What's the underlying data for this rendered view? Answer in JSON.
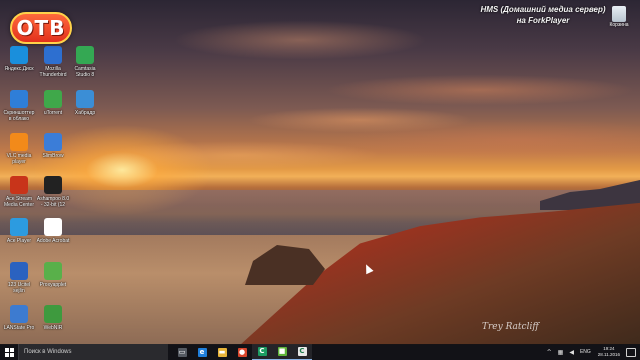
{
  "overlay": {
    "logo_text": "OTB",
    "caption_line1": "HMS (Домашний медиа сервер)",
    "caption_line2": "на ForkPlayer",
    "signature": "Trey Ratcliff"
  },
  "desktop_icons": [
    {
      "label": "Яндекс.Диск",
      "icon": "yandex-disk-icon",
      "color": "#1a8fdc"
    },
    {
      "label": "Mozilla Thunderbird",
      "icon": "thunderbird-icon",
      "color": "#2d6fd0"
    },
    {
      "label": "Camtasia Studio 8",
      "icon": "camtasia-icon",
      "color": "#34a853"
    },
    {
      "label": "Скриншоттер в облако",
      "icon": "screenshot-icon",
      "color": "#2f7ed8"
    },
    {
      "label": "uTorrent",
      "icon": "utorrent-icon",
      "color": "#3fa84a"
    },
    {
      "label": "Хабрадр",
      "icon": "monitor-icon",
      "color": "#3b8ed6"
    },
    {
      "label": "VLC media player",
      "icon": "vlc-icon",
      "color": "#f28a1a"
    },
    {
      "label": "SlimBrow",
      "icon": "slimbrowser-icon",
      "color": "#3b7dd8"
    },
    {
      "label": "Ace Stream Media Center",
      "icon": "acestream-icon",
      "color": "#c8341a"
    },
    {
      "label": "Ashampoo 8.0 - 32-bit (12",
      "icon": "clapper-icon",
      "color": "#222222"
    },
    {
      "label": "Ace Player",
      "icon": "ace-player-icon",
      "color": "#2c9be0"
    },
    {
      "label": "Adobe Acrobat",
      "icon": "acrobat-icon",
      "color": "#ffffff"
    },
    {
      "label": "123 Ucitel sejšn",
      "icon": "tv-icon",
      "color": "#2b62c0"
    },
    {
      "label": "Proxyapplet",
      "icon": "proxy-icon",
      "color": "#59b04a"
    },
    {
      "label": "LANState Pro",
      "icon": "lanstate-icon",
      "color": "#3d7bd0"
    },
    {
      "label": "WebNIR",
      "icon": "webnir-icon",
      "color": "#3e9a3e"
    }
  ],
  "recycle_bin": {
    "label": "Корзина"
  },
  "taskbar": {
    "search_placeholder": "Поиск в Windows",
    "pinned": [
      {
        "name": "task-view",
        "glyph": "▭",
        "color": "#555a62"
      },
      {
        "name": "edge",
        "glyph": "e",
        "color": "#1f7fdc"
      },
      {
        "name": "file-explorer",
        "glyph": "▬",
        "color": "#e8b43a"
      },
      {
        "name": "chrome",
        "glyph": "●",
        "color": "#d9462c"
      },
      {
        "name": "camtasia",
        "glyph": "C",
        "color": "#1c9c62"
      },
      {
        "name": "green-app",
        "glyph": "■",
        "color": "#5fb43a"
      },
      {
        "name": "camtasia-recorder",
        "glyph": "C",
        "color": "#e8e8e8"
      }
    ],
    "language": "ENG",
    "time": "19:24",
    "date": "28.11.2016"
  }
}
